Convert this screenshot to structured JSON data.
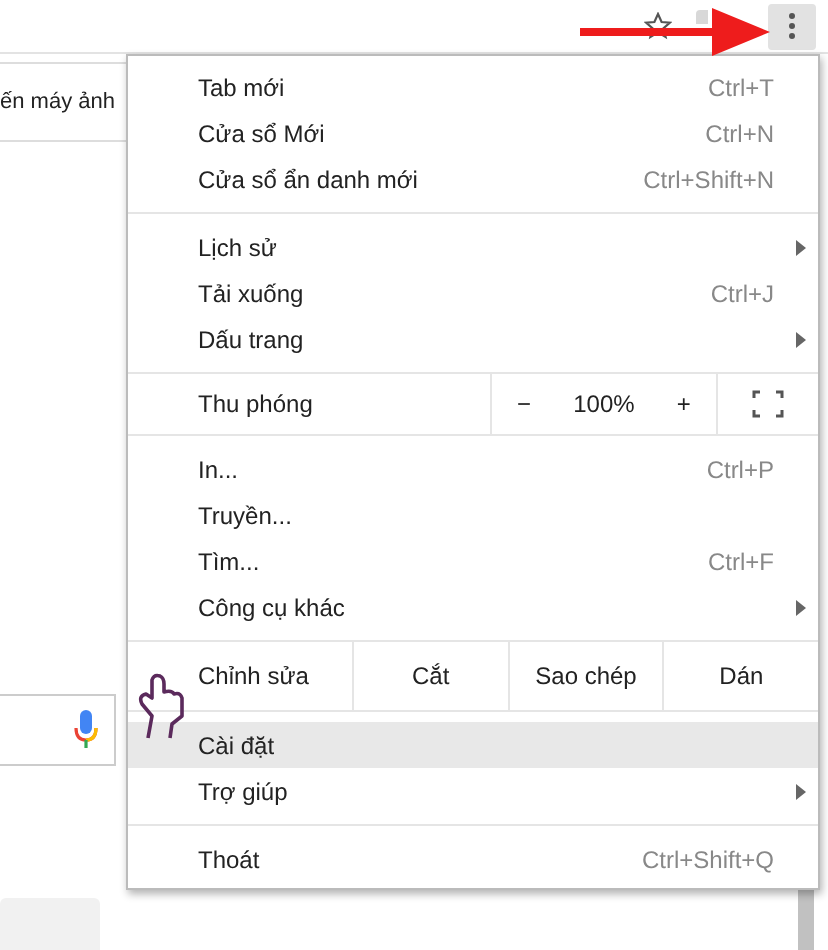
{
  "page": {
    "row_text": "ến máy ảnh"
  },
  "menu": {
    "sections": [
      {
        "items": [
          {
            "kind": "item",
            "label": "Tab mới",
            "shortcut": "Ctrl+T",
            "submenu": false,
            "selected": false
          },
          {
            "kind": "item",
            "label": "Cửa sổ Mới",
            "shortcut": "Ctrl+N",
            "submenu": false,
            "selected": false
          },
          {
            "kind": "item",
            "label": "Cửa sổ ẩn danh mới",
            "shortcut": "Ctrl+Shift+N",
            "submenu": false,
            "selected": false
          }
        ]
      },
      {
        "items": [
          {
            "kind": "item",
            "label": "Lịch sử",
            "submenu": true,
            "selected": false
          },
          {
            "kind": "item",
            "label": "Tải xuống",
            "shortcut": "Ctrl+J",
            "submenu": false,
            "selected": false
          },
          {
            "kind": "item",
            "label": "Dấu trang",
            "submenu": true,
            "selected": false
          }
        ]
      },
      {
        "items": [
          {
            "kind": "zoom",
            "label": "Thu phóng",
            "minus": "−",
            "value": "100%",
            "plus": "+"
          }
        ]
      },
      {
        "items": [
          {
            "kind": "item",
            "label": "In...",
            "shortcut": "Ctrl+P",
            "submenu": false,
            "selected": false
          },
          {
            "kind": "item",
            "label": "Truyền...",
            "submenu": false,
            "selected": false
          },
          {
            "kind": "item",
            "label": "Tìm...",
            "shortcut": "Ctrl+F",
            "submenu": false,
            "selected": false
          },
          {
            "kind": "item",
            "label": "Công cụ khác",
            "submenu": true,
            "selected": false
          }
        ]
      },
      {
        "items": [
          {
            "kind": "edit",
            "label": "Chỉnh sửa",
            "buttons": [
              "Cắt",
              "Sao chép",
              "Dán"
            ]
          },
          {
            "kind": "item",
            "label": "Cài đặt",
            "submenu": false,
            "selected": true
          },
          {
            "kind": "item",
            "label": "Trợ giúp",
            "submenu": true,
            "selected": false
          }
        ]
      },
      {
        "items": [
          {
            "kind": "item",
            "label": "Thoát",
            "shortcut": "Ctrl+Shift+Q",
            "submenu": false,
            "selected": false
          }
        ]
      }
    ]
  }
}
